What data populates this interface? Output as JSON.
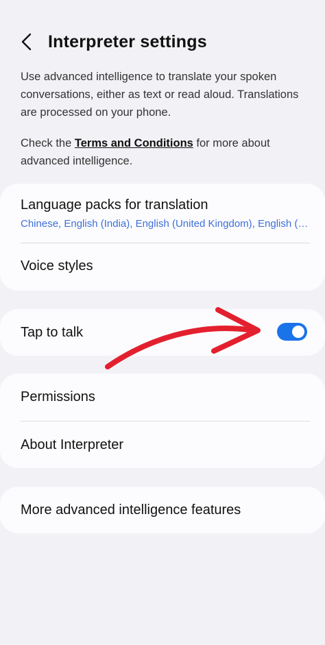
{
  "header": {
    "back_icon": "chevron-left-icon",
    "title": "Interpreter settings"
  },
  "description": {
    "intro": "Use advanced intelligence to translate your spoken conversations, either as text or read aloud. Translations are processed on your phone.",
    "check_prefix": "Check the ",
    "terms_link": "Terms and Conditions",
    "check_suffix": " for more about advanced intelligence."
  },
  "sections": {
    "language_packs": {
      "label": "Language packs for translation",
      "value": "Chinese, English (India), English (United Kingdom), English (United States)"
    },
    "voice_styles": {
      "label": "Voice styles"
    },
    "tap_to_talk": {
      "label": "Tap to talk",
      "enabled": true
    },
    "permissions": {
      "label": "Permissions"
    },
    "about": {
      "label": "About Interpreter"
    },
    "more_features": {
      "label": "More advanced intelligence features"
    }
  },
  "colors": {
    "accent": "#1a73e8",
    "link_value": "#3e6fd8",
    "annotation_arrow": "#e3202e",
    "background": "#f2f2f6",
    "card": "#fcfcfe"
  }
}
